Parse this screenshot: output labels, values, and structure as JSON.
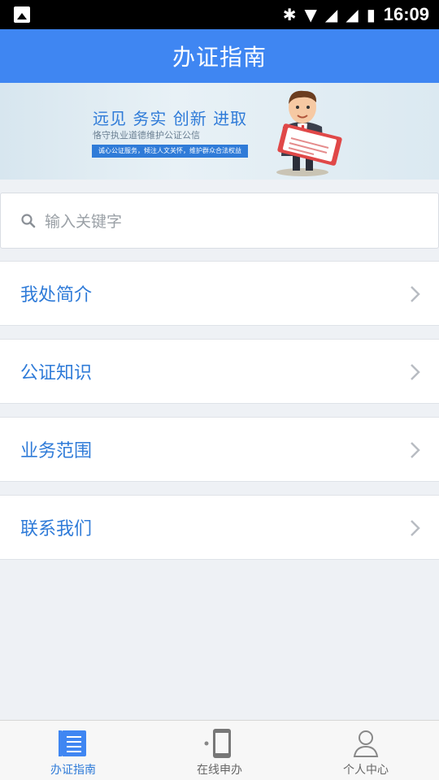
{
  "status_bar": {
    "time": "16:09"
  },
  "header": {
    "title": "办证指南"
  },
  "banner": {
    "headline": "远见 务实 创新 进取",
    "subline": "恪守执业道德维护公证公信",
    "tagline": "诚心公证服务，倾注人文关怀，维护群众合法权益"
  },
  "search": {
    "placeholder": "输入关键字"
  },
  "menu": {
    "items": [
      {
        "label": "我处简介"
      },
      {
        "label": "公证知识"
      },
      {
        "label": "业务范围"
      },
      {
        "label": "联系我们"
      }
    ]
  },
  "bottom_nav": {
    "tabs": [
      {
        "label": "办证指南",
        "icon": "guide-list-icon",
        "active": true
      },
      {
        "label": "在线申办",
        "icon": "phone-icon",
        "active": false
      },
      {
        "label": "个人中心",
        "icon": "user-icon",
        "active": false
      }
    ]
  },
  "colors": {
    "accent": "#3f86f2",
    "text_blue": "#2f7bd8",
    "background": "#eef1f5"
  }
}
